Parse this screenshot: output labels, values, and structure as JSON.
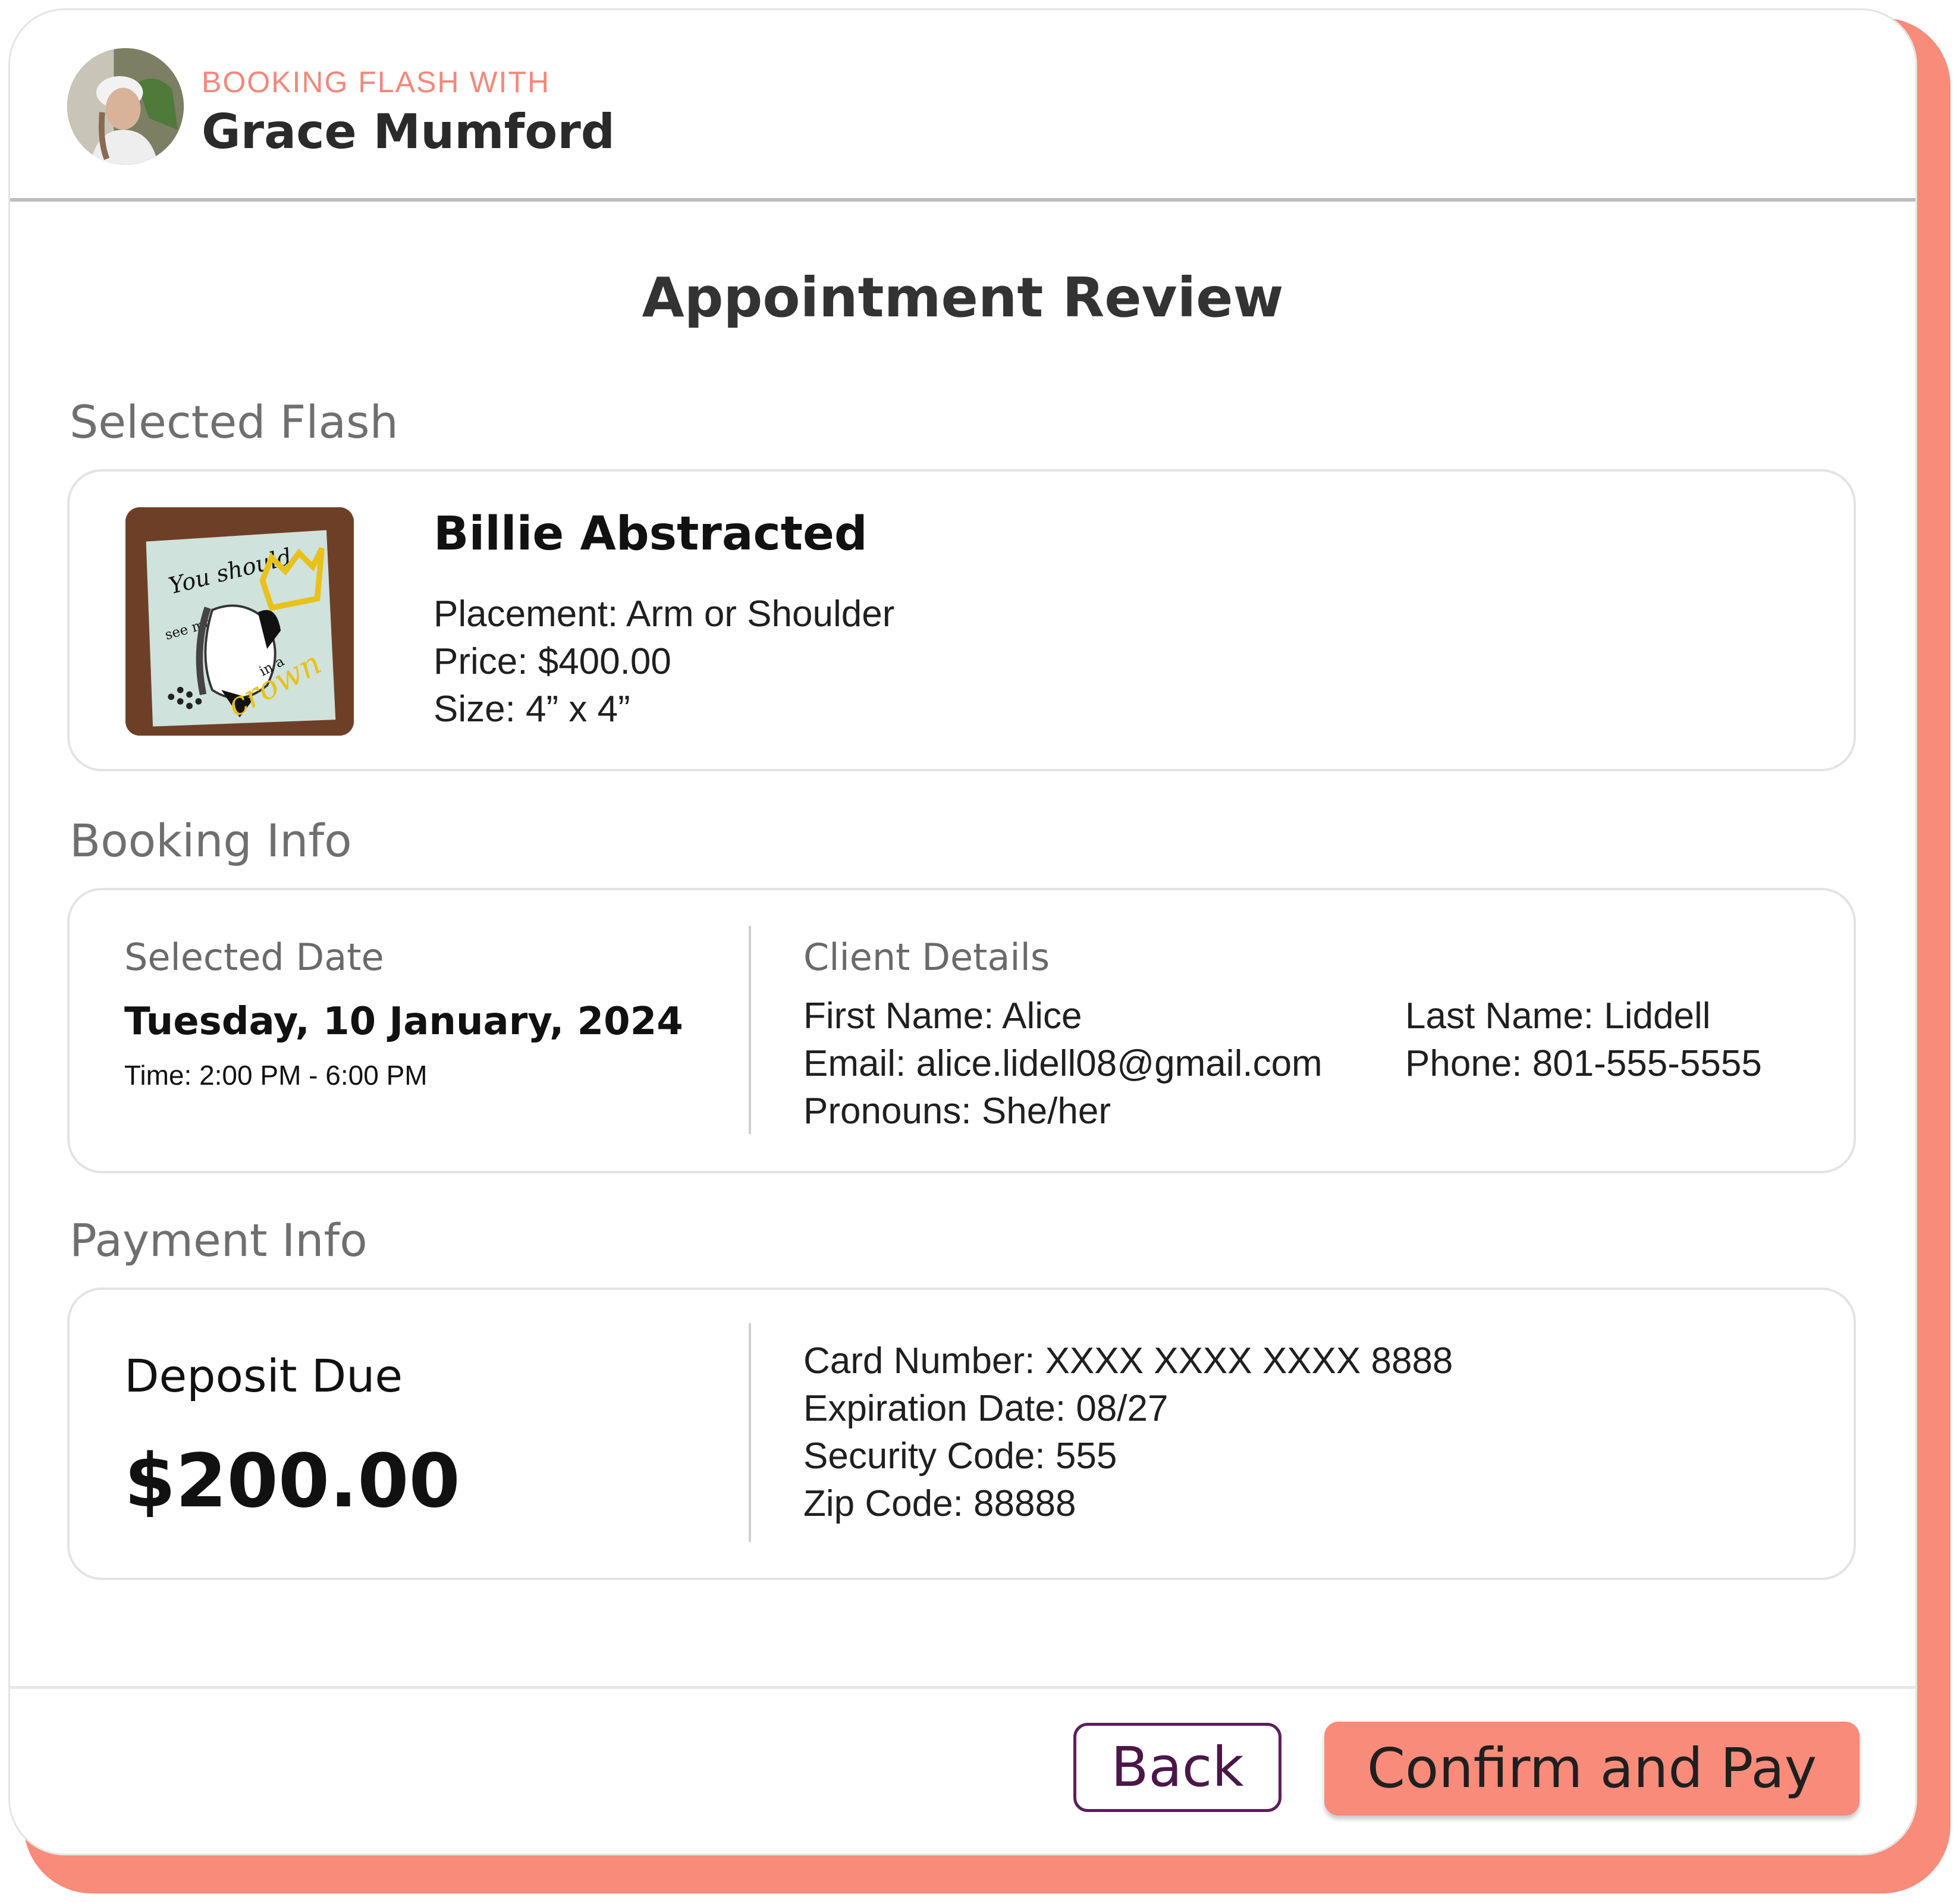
{
  "header": {
    "eyebrow": "BOOKING FLASH WITH",
    "artist_name": "Grace Mumford"
  },
  "page_title": "Appointment Review",
  "selected_flash": {
    "section_label": "Selected Flash",
    "title": "Billie Abstracted",
    "placement": "Placement: Arm or Shoulder",
    "price": "Price: $400.00",
    "size": "Size: 4” x 4”",
    "image_lettering": [
      "You should",
      "see me",
      "in a",
      "crown"
    ]
  },
  "booking_info": {
    "section_label": "Booking Info",
    "date_label": "Selected Date",
    "date": "Tuesday, 10 January, 2024",
    "time": "Time: 2:00 PM - 6:00 PM",
    "client_label": "Client Details",
    "first_name": "First Name: Alice",
    "last_name": "Last Name: Liddell",
    "email": "Email: alice.lidell08@gmail.com",
    "phone": "Phone: 801-555-5555",
    "pronouns": "Pronouns: She/her"
  },
  "payment_info": {
    "section_label": "Payment Info",
    "deposit_label": "Deposit Due",
    "deposit_amount": "$200.00",
    "card_number": "Card Number: XXXX XXXX XXXX 8888",
    "expiration": "Expiration Date: 08/27",
    "security_code": "Security Code: 555",
    "zip_code": "Zip Code: 88888"
  },
  "actions": {
    "back_label": "Back",
    "confirm_label": "Confirm and Pay"
  },
  "colors": {
    "accent": "#F98B7A",
    "back_button_border": "#5b1f5c",
    "muted_text": "#6f6f6f"
  }
}
